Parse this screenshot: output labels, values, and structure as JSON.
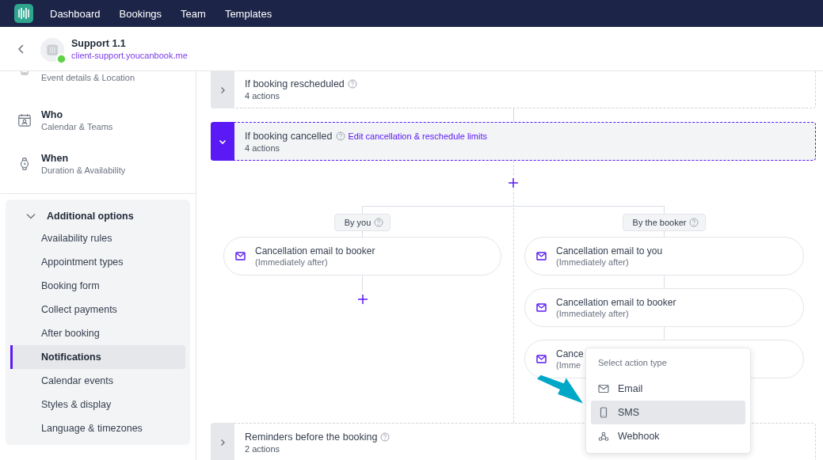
{
  "top_nav": {
    "items": [
      {
        "label": "Dashboard"
      },
      {
        "label": "Bookings"
      },
      {
        "label": "Team"
      },
      {
        "label": "Templates"
      }
    ]
  },
  "page_header": {
    "title": "Support 1.1",
    "url": "client-support.youcanbook.me"
  },
  "sidebar": {
    "steps": [
      {
        "kind": "event",
        "subtitle": "Event details & Location"
      },
      {
        "kind": "who",
        "title": "Who",
        "subtitle": "Calendar & Teams"
      },
      {
        "kind": "when",
        "title": "When",
        "subtitle": "Duration & Availability"
      }
    ],
    "additional_options": {
      "title": "Additional options",
      "expanded": true,
      "items": [
        {
          "label": "Availability rules",
          "selected": false
        },
        {
          "label": "Appointment types",
          "selected": false
        },
        {
          "label": "Booking form",
          "selected": false
        },
        {
          "label": "Collect payments",
          "selected": false
        },
        {
          "label": "After booking",
          "selected": false
        },
        {
          "label": "Notifications",
          "selected": true
        },
        {
          "label": "Calendar events",
          "selected": false
        },
        {
          "label": "Styles & display",
          "selected": false
        },
        {
          "label": "Language & timezones",
          "selected": false
        }
      ]
    }
  },
  "triggers": [
    {
      "title": "If booking rescheduled",
      "count": "4 actions",
      "expanded": false
    },
    {
      "title": "If booking cancelled",
      "link": "Edit cancellation & reschedule limits",
      "count": "4 actions",
      "expanded": true,
      "branches": [
        {
          "label": "By you",
          "actions": [
            {
              "title": "Cancellation email to booker",
              "timing": "(Immediately after)"
            }
          ]
        },
        {
          "label": "By the booker",
          "actions": [
            {
              "title": "Cancellation email to you",
              "timing": "(Immediately after)"
            },
            {
              "title": "Cancellation email to booker",
              "timing": "(Immediately after)"
            },
            {
              "title": "Cance",
              "timing": "(Imme"
            }
          ]
        }
      ]
    },
    {
      "title": "Reminders before the booking",
      "count": "2 actions",
      "expanded": false
    }
  ],
  "action_menu": {
    "title": "Select action type",
    "items": [
      {
        "label": "Email",
        "kind": "email",
        "selected": false
      },
      {
        "label": "SMS",
        "kind": "sms",
        "selected": true
      },
      {
        "label": "Webhook",
        "kind": "webhook",
        "selected": false
      }
    ]
  }
}
